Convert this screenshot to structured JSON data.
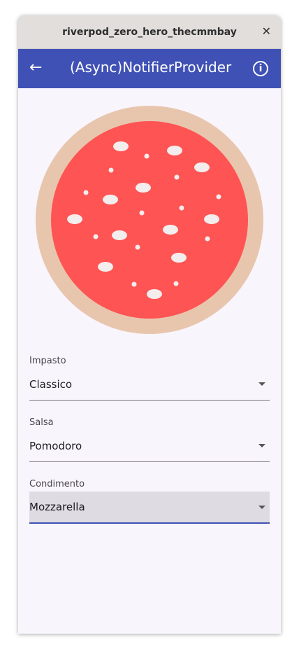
{
  "window": {
    "title": "riverpod_zero_hero_thecmmbay",
    "close_icon": "close-icon"
  },
  "appbar": {
    "title": "(Async)NotifierProvider",
    "back_icon": "arrow-back-icon",
    "info_icon": "info-icon",
    "color": "#3f51b5"
  },
  "pizza": {
    "crust_color": "#e8c6ae",
    "sauce_color": "#fe5454",
    "cheese_color": "#f3eded"
  },
  "fields": [
    {
      "label": "Impasto",
      "value": "Classico"
    },
    {
      "label": "Salsa",
      "value": "Pomodoro"
    },
    {
      "label": "Condimento",
      "value": "Mozzarella"
    }
  ]
}
